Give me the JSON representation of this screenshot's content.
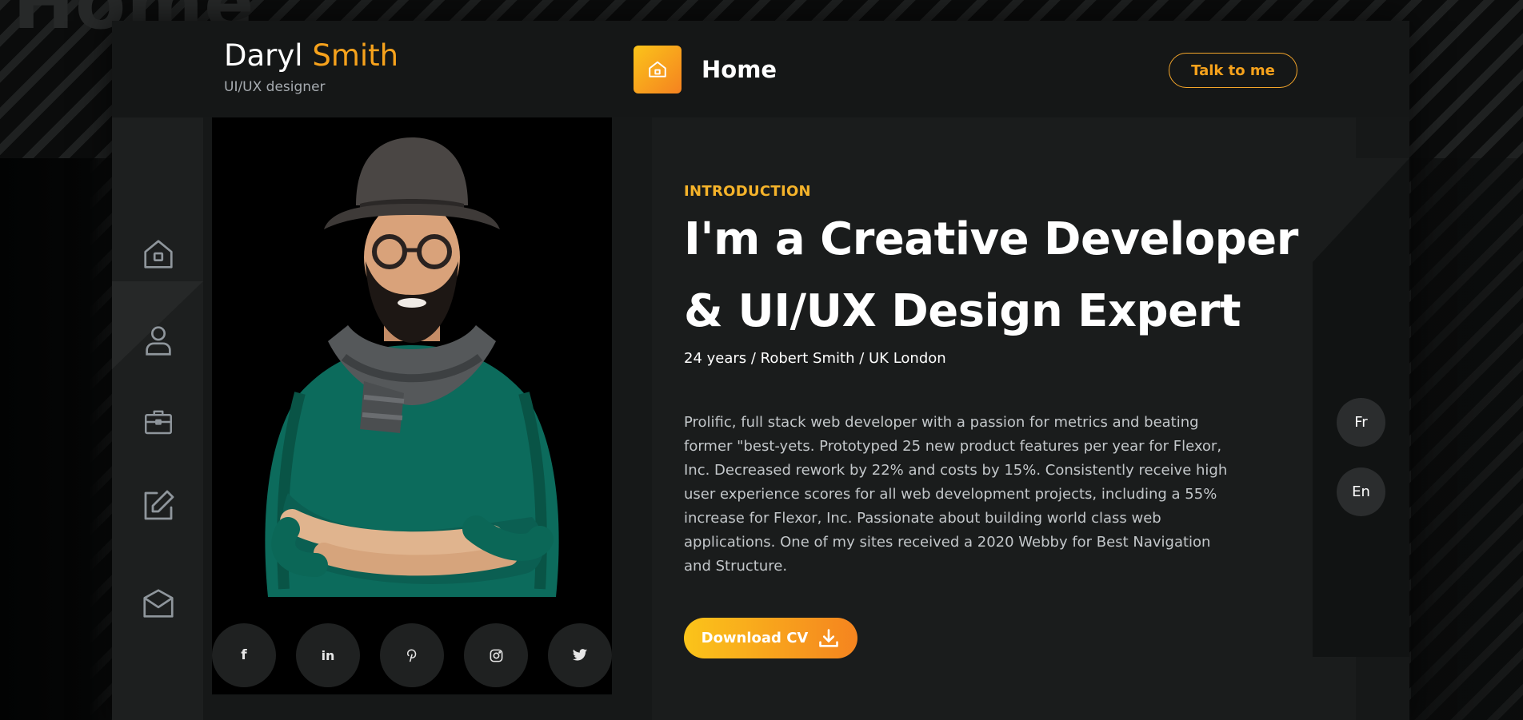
{
  "background": {
    "watermark_text": "Home"
  },
  "brand": {
    "first_name": "Daryl",
    "last_name": "Smith",
    "role": "UI/UX designer",
    "accent_color": "#f6a21c"
  },
  "header": {
    "page_icon": "home-icon",
    "page_title": "Home",
    "cta_label": "Talk to me"
  },
  "sidenav": {
    "items": [
      {
        "name": "home",
        "icon": "home-icon"
      },
      {
        "name": "about",
        "icon": "user-icon"
      },
      {
        "name": "portfolio",
        "icon": "briefcase-icon"
      },
      {
        "name": "blog",
        "icon": "edit-icon"
      },
      {
        "name": "contact",
        "icon": "mail-icon"
      }
    ]
  },
  "socials": [
    {
      "name": "facebook",
      "glyph": "f"
    },
    {
      "name": "linkedin",
      "glyph": "in"
    },
    {
      "name": "pinterest",
      "icon": "pinterest-icon"
    },
    {
      "name": "instagram",
      "icon": "instagram-icon"
    },
    {
      "name": "twitter",
      "icon": "twitter-icon"
    }
  ],
  "intro": {
    "eyebrow": "INTRODUCTION",
    "headline": "I'm a Creative Developer & UI/UX Design Expert",
    "meta": "24 years / Robert Smith / UK London",
    "bio": "Prolific, full stack web developer with a passion for metrics and beating former \"best-yets. Prototyped 25 new product features per year for Flexor, Inc. Decreased rework by 22% and costs by 15%. Consistently receive high user experience scores for all web development projects, including a 55% increase for Flexor, Inc. Passionate about building world class web applications. One of my sites received a 2020 Webby for Best Navigation and Structure.",
    "download_label": "Download CV",
    "download_icon": "download-icon"
  },
  "languages": [
    "Fr",
    "En"
  ],
  "colors": {
    "gradient_start": "#fbc41a",
    "gradient_end": "#f5841f",
    "eyebrow": "#f5b32a"
  }
}
